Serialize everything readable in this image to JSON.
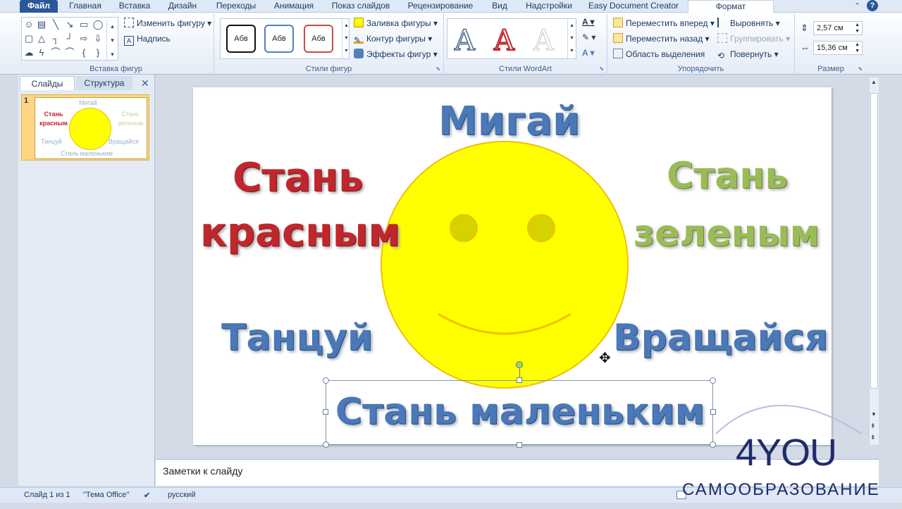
{
  "ribbon_tabs": [
    "Файл",
    "Главная",
    "Вставка",
    "Дизайн",
    "Переходы",
    "Анимация",
    "Показ слайдов",
    "Рецензирование",
    "Вид",
    "Надстройки",
    "Easy Document Creator",
    "Формат"
  ],
  "ribbon": {
    "insert_shapes": {
      "label": "Вставка фигур",
      "edit_shape": "Изменить фигуру",
      "textbox": "Надпись"
    },
    "shape_styles": {
      "label": "Стили фигур",
      "preset_text": "Абв",
      "fill": "Заливка фигуры",
      "outline": "Контур фигуры",
      "effects": "Эффекты фигур"
    },
    "wordart": {
      "label": "Стили WordArt",
      "glyph": "A"
    },
    "arrange": {
      "label": "Упорядочить",
      "bring_forward": "Переместить вперед",
      "send_backward": "Переместить назад",
      "selection_pane": "Область выделения",
      "align": "Выровнять",
      "group": "Группировать",
      "rotate": "Повернуть"
    },
    "size": {
      "label": "Размер",
      "height": "2,57 см",
      "width": "15,36 см"
    }
  },
  "left_panel": {
    "tab_slides": "Слайды",
    "tab_outline": "Структура",
    "slide_number": "1",
    "thumb_texts": {
      "top": "Мигай",
      "red": "Стань красным",
      "green": "Стань зеленым",
      "dance": "Танцуй",
      "rotate": "Вращайся",
      "small": "Стань маленьким"
    }
  },
  "slide": {
    "blink": "Мигай",
    "red_line1": "Стань",
    "red_line2": "красным",
    "green_line1": "Стань",
    "green_line2": "зеленым",
    "dance": "Танцуй",
    "rotate": "Вращайся",
    "small": "Стань маленьким"
  },
  "notes_placeholder": "Заметки к слайду",
  "status": {
    "slide_info": "Слайд 1 из 1",
    "theme": "\"Тема Office\"",
    "language": "русский"
  },
  "watermark": {
    "brand": "4YOU",
    "subtitle": "САМООБРАЗОВАНИЕ"
  },
  "colors": {
    "wordart_blue": "#4a78b8",
    "wordart_red": "#c0272d",
    "wordart_green": "#9bbb59",
    "smiley_yellow": "#ffff00",
    "file_tab": "#2b579a"
  }
}
